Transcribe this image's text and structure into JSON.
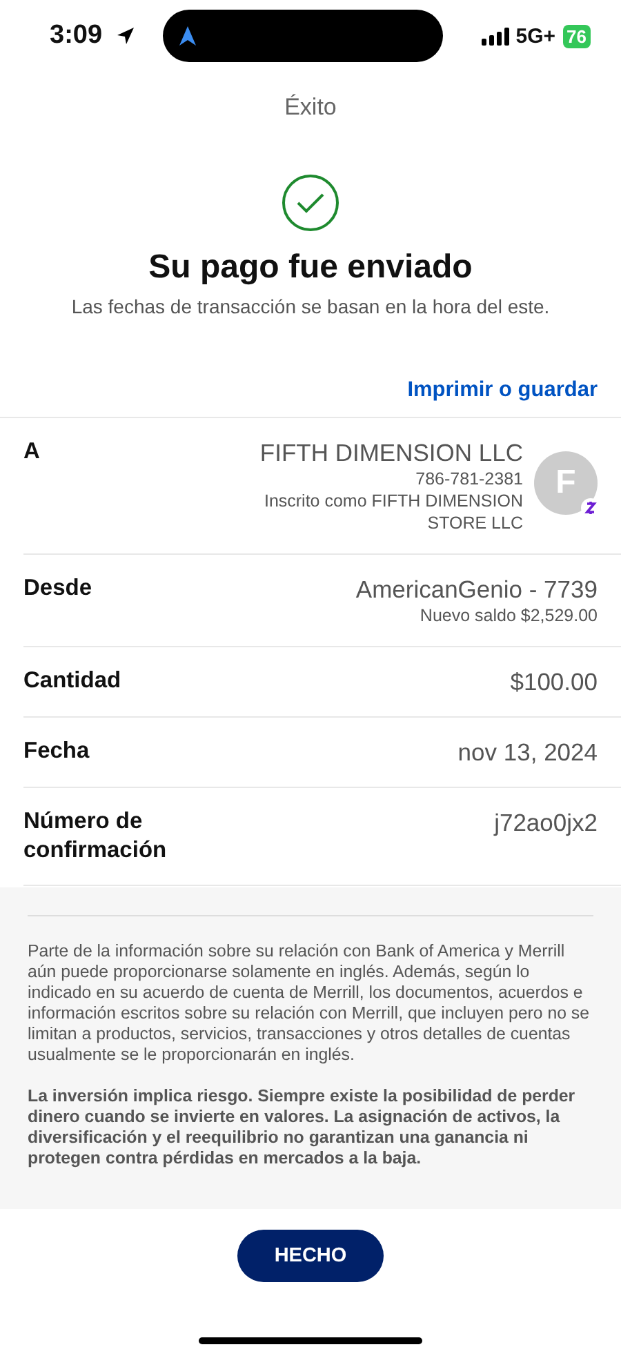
{
  "status_bar": {
    "time": "3:09",
    "network": "5G+",
    "battery": "76"
  },
  "header": {
    "title": "Éxito"
  },
  "result": {
    "heading": "Su pago fue enviado",
    "subtitle": "Las fechas de transacción se basan en la hora del este."
  },
  "print_link": "Imprimir o guardar",
  "details": [
    {
      "label": "A",
      "value": "FIFTH DIMENSION LLC",
      "lines": [
        "786-781-2381",
        "Inscrito como FIFTH DIMENSION STORE LLC"
      ],
      "avatar": {
        "initial": "F"
      }
    },
    {
      "label": "Desde",
      "value": "AmericanGenio - 7739",
      "lines": [
        "Nuevo saldo $2,529.00"
      ]
    },
    {
      "label": "Cantidad",
      "value": "$100.00"
    },
    {
      "label": "Fecha",
      "value": "nov 13, 2024"
    },
    {
      "label": "Número de confirmación",
      "value": "j72ao0jx2"
    }
  ],
  "disclaimer": [
    {
      "text": "Parte de la información sobre su relación con Bank of America y Merrill aún puede proporcionarse solamente en inglés. Además, según lo indicado en su acuerdo de cuenta de Merrill, los documentos, acuerdos e información escritos sobre su relación con Merrill, que incluyen pero no se limitan a productos, servicios, transacciones y otros detalles de cuentas usualmente se le proporcionarán en inglés.",
      "bold": false
    },
    {
      "text": "La inversión implica riesgo. Siempre existe la posibilidad de perder dinero cuando se invierte en valores. La asignación de activos, la diversificación y el reequilibrio no garantizan una ganancia ni protegen contra pérdidas en mercados a la baja.",
      "bold": true
    }
  ],
  "done_button": "HECHO"
}
